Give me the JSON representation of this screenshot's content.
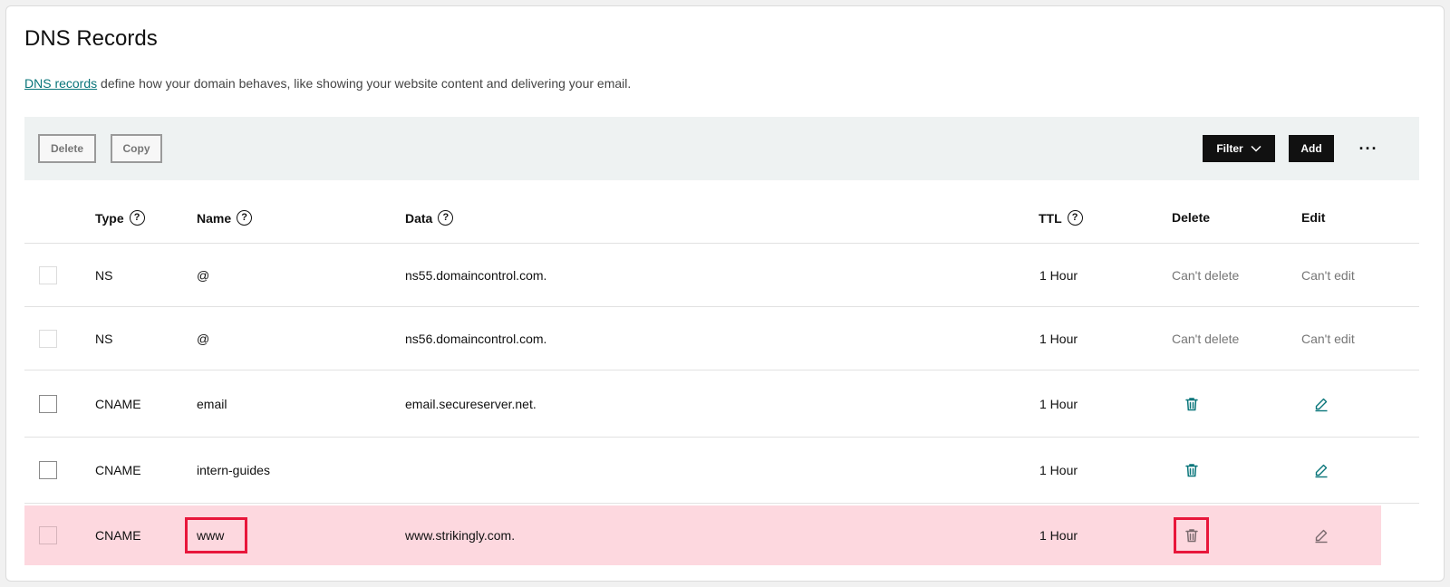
{
  "page": {
    "title": "DNS Records",
    "description_link": "DNS records",
    "description_text": " define how your domain behaves, like showing your website content and delivering your email."
  },
  "toolbar": {
    "delete_label": "Delete",
    "copy_label": "Copy",
    "filter_label": "Filter",
    "add_label": "Add",
    "more_label": "···"
  },
  "table": {
    "headers": {
      "type": "Type",
      "name": "Name",
      "data": "Data",
      "ttl": "TTL",
      "delete": "Delete",
      "edit": "Edit"
    },
    "help_glyph": "?",
    "rows": [
      {
        "type": "NS",
        "name": "@",
        "data": "ns55.domaincontrol.com.",
        "ttl": "1 Hour",
        "delete": "Can't delete",
        "edit": "Can't edit"
      },
      {
        "type": "NS",
        "name": "@",
        "data": "ns56.domaincontrol.com.",
        "ttl": "1 Hour",
        "delete": "Can't delete",
        "edit": "Can't edit"
      },
      {
        "type": "CNAME",
        "name": "email",
        "data": "email.secureserver.net.",
        "ttl": "1 Hour"
      },
      {
        "type": "CNAME",
        "name": "intern-guides",
        "data": "",
        "ttl": "1 Hour"
      },
      {
        "type": "CNAME",
        "name": "www",
        "data": "www.strikingly.com.",
        "ttl": "1 Hour"
      }
    ]
  },
  "colors": {
    "accent": "#09757a",
    "highlight_row": "#fdd8df",
    "annotation_red": "#e8173b",
    "toolbar_bg": "#eef2f2"
  },
  "icons": {
    "delete": "trash-icon",
    "edit": "pencil-icon",
    "filter_chevron": "chevron-down-icon",
    "more": "more-horizontal-icon",
    "help": "help-circle-icon"
  }
}
